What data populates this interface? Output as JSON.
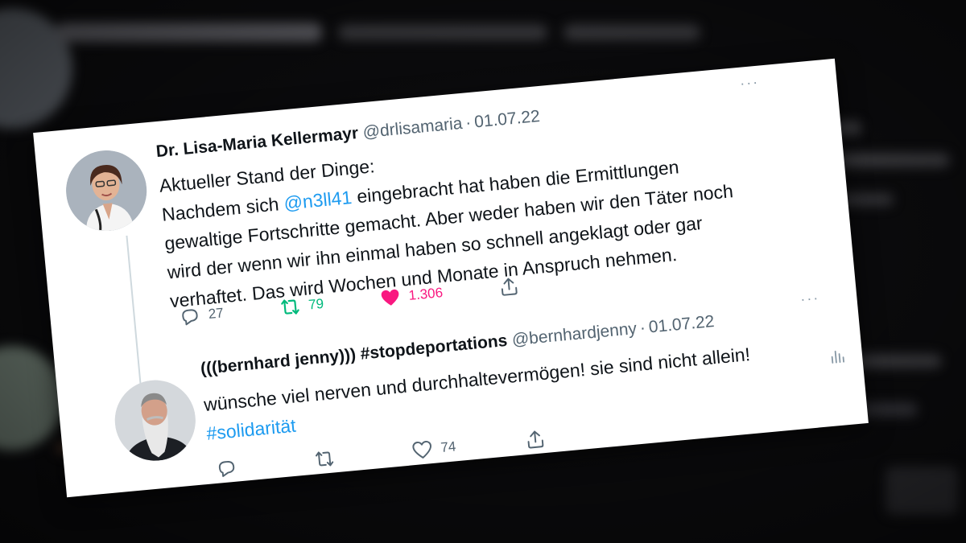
{
  "tweets": [
    {
      "author_name": "Dr. Lisa-Maria Kellermayr",
      "handle": "@drlisamaria",
      "date": "01.07.22",
      "text_line1": "Aktueller Stand der Dinge:",
      "text_pre": "Nachdem sich ",
      "mention": "@n3ll41",
      "text_post": " eingebracht hat haben die Ermittlungen gewaltige Fortschritte gemacht. Aber weder haben wir den Täter noch wird der wenn wir ihn einmal haben so schnell angeklagt oder gar verhaftet. Das wird Wochen und Monate in Anspruch nehmen.",
      "replies": "27",
      "retweets": "79",
      "likes": "1.306",
      "liked": true,
      "retweeted": true
    },
    {
      "author_name": "(((bernhard jenny))) #stopdeportations",
      "handle": "@bernhardjenny",
      "date": "01.07.22",
      "text": "wünsche viel nerven und durchhaltevermögen! sie sind nicht allein!",
      "hashtag": "#solidarität",
      "replies": "",
      "retweets": "",
      "likes": "74",
      "liked": false,
      "retweeted": false
    }
  ],
  "colors": {
    "accent": "#1d9bf0",
    "retweet": "#00ba7c",
    "like": "#f91880",
    "text": "#0f1419",
    "muted": "#536471"
  },
  "icons": [
    "reply-icon",
    "retweet-icon",
    "like-icon",
    "share-icon",
    "analytics-icon",
    "more-icon"
  ]
}
